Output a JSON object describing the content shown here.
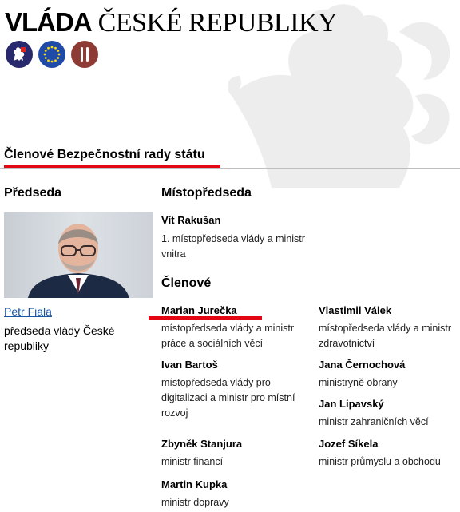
{
  "brand": {
    "bold": "VLÁDA",
    "rest": "ČESKÉ REPUBLIKY"
  },
  "icons": [
    "lion-emblem-icon",
    "eu-stars-icon",
    "columns-icon"
  ],
  "page_title": "Členové Bezpečnostní rady státu",
  "chair": {
    "heading": "Předseda",
    "name": "Petr Fiala",
    "role": "předseda vlády České republiky"
  },
  "vice": {
    "heading": "Místopředseda",
    "name": "Vít Rakušan",
    "role": "1. místopředseda vlády a ministr vnitra"
  },
  "members": {
    "heading": "Členové",
    "left": [
      {
        "name": "Marian Jurečka",
        "role": "místopředseda vlády a ministr práce a sociálních věcí"
      },
      {
        "name": "Ivan Bartoš",
        "role": "místopředseda vlády pro digitalizaci a ministr pro místní rozvoj"
      },
      {
        "name": "Zbyněk Stanjura",
        "role": "ministr financí"
      },
      {
        "name": "Martin Kupka",
        "role": "ministr dopravy"
      }
    ],
    "right": [
      {
        "name": "Vlastimil Válek",
        "role": "místopředseda vlády a ministr zdravotnictví"
      },
      {
        "name": "Jana Černochová",
        "role": "ministryně obrany"
      },
      {
        "name": "Jan Lipavský",
        "role": "ministr zahraničních věcí"
      },
      {
        "name": "Jozef Síkela",
        "role": "ministr průmyslu a obchodu"
      }
    ]
  },
  "colors": {
    "accent_red": "#e30613",
    "link": "#1a55a5"
  }
}
